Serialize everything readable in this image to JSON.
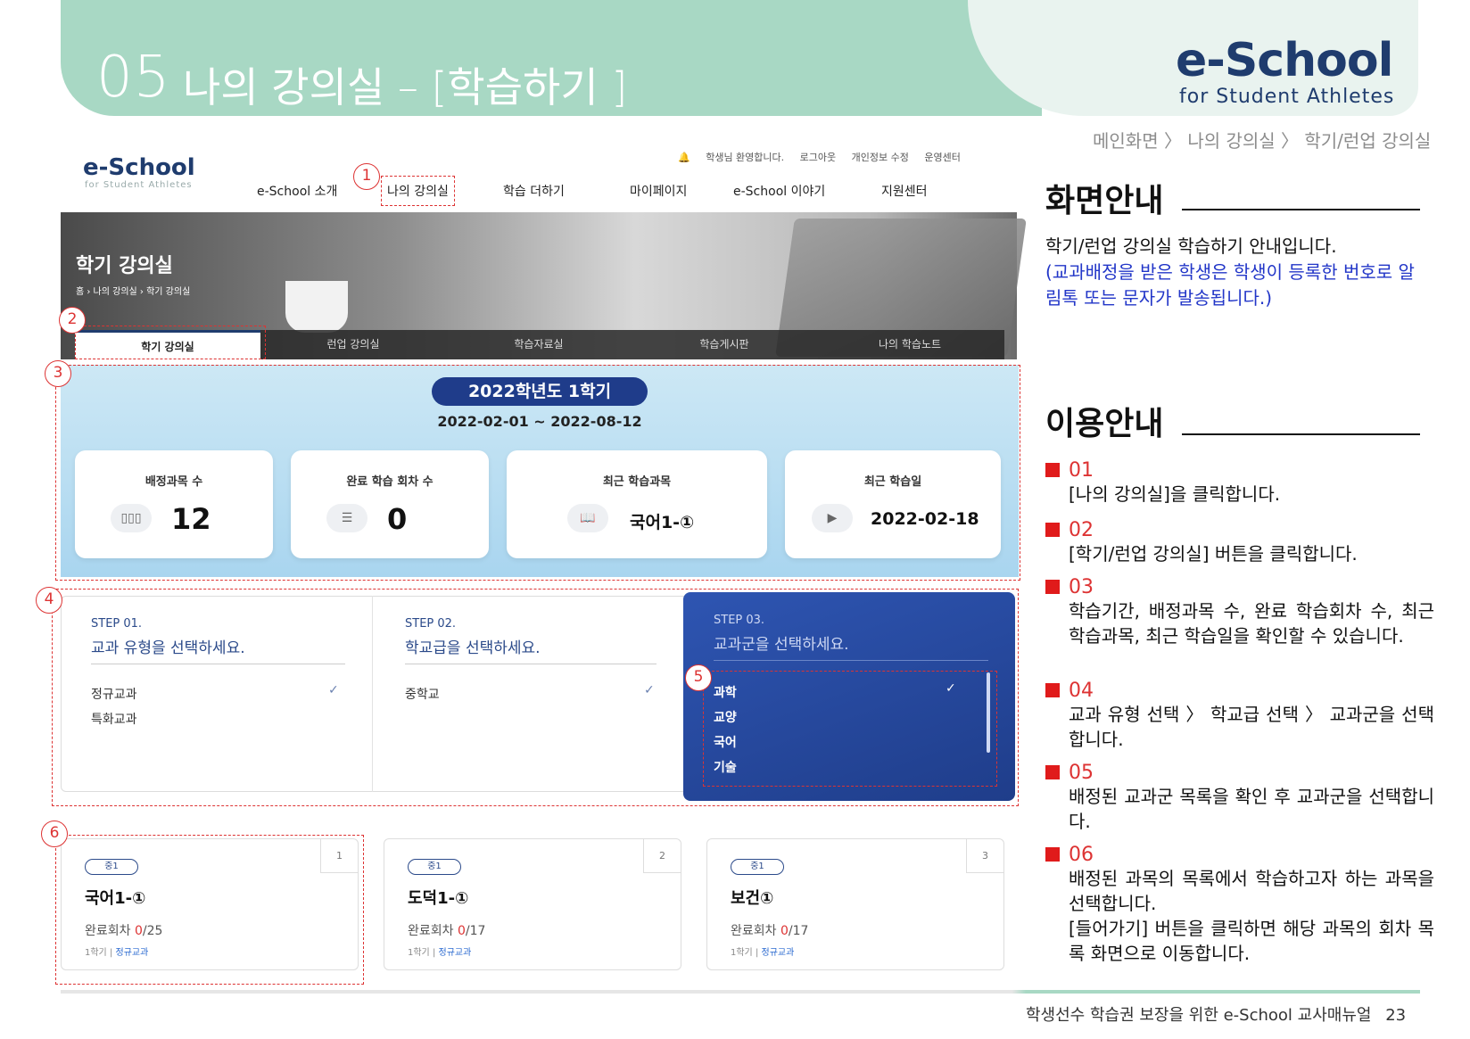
{
  "header": {
    "number": "05",
    "title": "나의 강의실 – [학습하기 ]",
    "brand": "e-School",
    "brand_sub": "for Student Athletes",
    "breadcrumb": "메인화면 〉 나의 강의실 〉 학기/런업 강의실"
  },
  "site": {
    "logo": "e-School",
    "logo_sub": "for Student Athletes",
    "top_links": [
      "학생님 환영합니다.",
      "로그아웃",
      "개인정보 수정",
      "운영센터"
    ],
    "nav": [
      "e-School 소개",
      "나의 강의실",
      "학습 더하기",
      "마이페이지",
      "e-School 이야기",
      "지원센터"
    ],
    "hero_title": "학기 강의실",
    "hero_crumb": "홈 › 나의 강의실 › 학기 강의실",
    "subtabs": [
      "학기 강의실",
      "런업 강의실",
      "학습자료실",
      "학습게시판",
      "나의 학습노트"
    ],
    "term": {
      "year_label": "2022학년도 1학기",
      "date_range": "2022-02-01 ~ 2022-08-12"
    },
    "stats": [
      {
        "label": "배정과목 수",
        "value": "12",
        "icon": "books-icon"
      },
      {
        "label": "완료 학습 회차 수",
        "value": "0",
        "icon": "list-icon"
      },
      {
        "label": "최근 학습과목",
        "value": "국어1-①",
        "icon": "book-icon"
      },
      {
        "label": "최근 학습일",
        "value": "2022-02-18",
        "icon": "play-icon"
      }
    ],
    "steps": [
      {
        "label": "STEP 01.",
        "title": "교과 유형을 선택하세요.",
        "items": [
          "정규교과",
          "특화교과"
        ]
      },
      {
        "label": "STEP 02.",
        "title": "학교급을 선택하세요.",
        "items": [
          "중학교"
        ]
      },
      {
        "label": "STEP 03.",
        "title": "교과군을 선택하세요.",
        "items": [
          "과학",
          "교양",
          "국어",
          "기술"
        ]
      }
    ],
    "courses": [
      {
        "num": "1",
        "badge": "중1",
        "name": "국어1-①",
        "progress_label": "완료회차",
        "done": "0",
        "total": "/25",
        "term": "1학기",
        "type": "정규교과"
      },
      {
        "num": "2",
        "badge": "중1",
        "name": "도덕1-①",
        "progress_label": "완료회차",
        "done": "0",
        "total": "/17",
        "term": "1학기",
        "type": "정규교과"
      },
      {
        "num": "3",
        "badge": "중1",
        "name": "보건①",
        "progress_label": "완료회차",
        "done": "0",
        "total": "/17",
        "term": "1학기",
        "type": "정규교과"
      }
    ]
  },
  "markers": [
    "1",
    "2",
    "3",
    "4",
    "5",
    "6"
  ],
  "panel": {
    "screen_heading": "화면안내",
    "intro_line": "학기/런업 강의실 학습하기 안내입니다.",
    "intro_note": "(교과배정을 받은 학생은 학생이 등록한 번호로 알림톡 또는 문자가 발송됩니다.)",
    "use_heading": "이용안내",
    "items": [
      {
        "num": "01",
        "desc": "[나의 강의실]을 클릭합니다."
      },
      {
        "num": "02",
        "desc": "[학기/런업 강의실] 버튼을 클릭합니다."
      },
      {
        "num": "03",
        "desc": "학습기간, 배정과목 수, 완료 학습회차 수, 최근 학습과목, 최근 학습일을 확인할 수 있습니다."
      },
      {
        "num": "04",
        "desc": "교과 유형 선택 〉 학교급 선택 〉 교과군을 선택합니다."
      },
      {
        "num": "05",
        "desc": "배정된 교과군 목록을 확인 후 교과군을 선택합니다."
      },
      {
        "num": "06",
        "desc": "배정된 과목의 목록에서 학습하고자 하는 과목을 선택합니다."
      }
    ],
    "item6_extra": "[들어가기] 버튼을 클릭하면 해당 과목의 회차 목록 화면으로 이동합니다."
  },
  "footer": {
    "text": "학생선수 학습권 보장을 위한 e-School 교사매뉴얼",
    "page": "23"
  }
}
